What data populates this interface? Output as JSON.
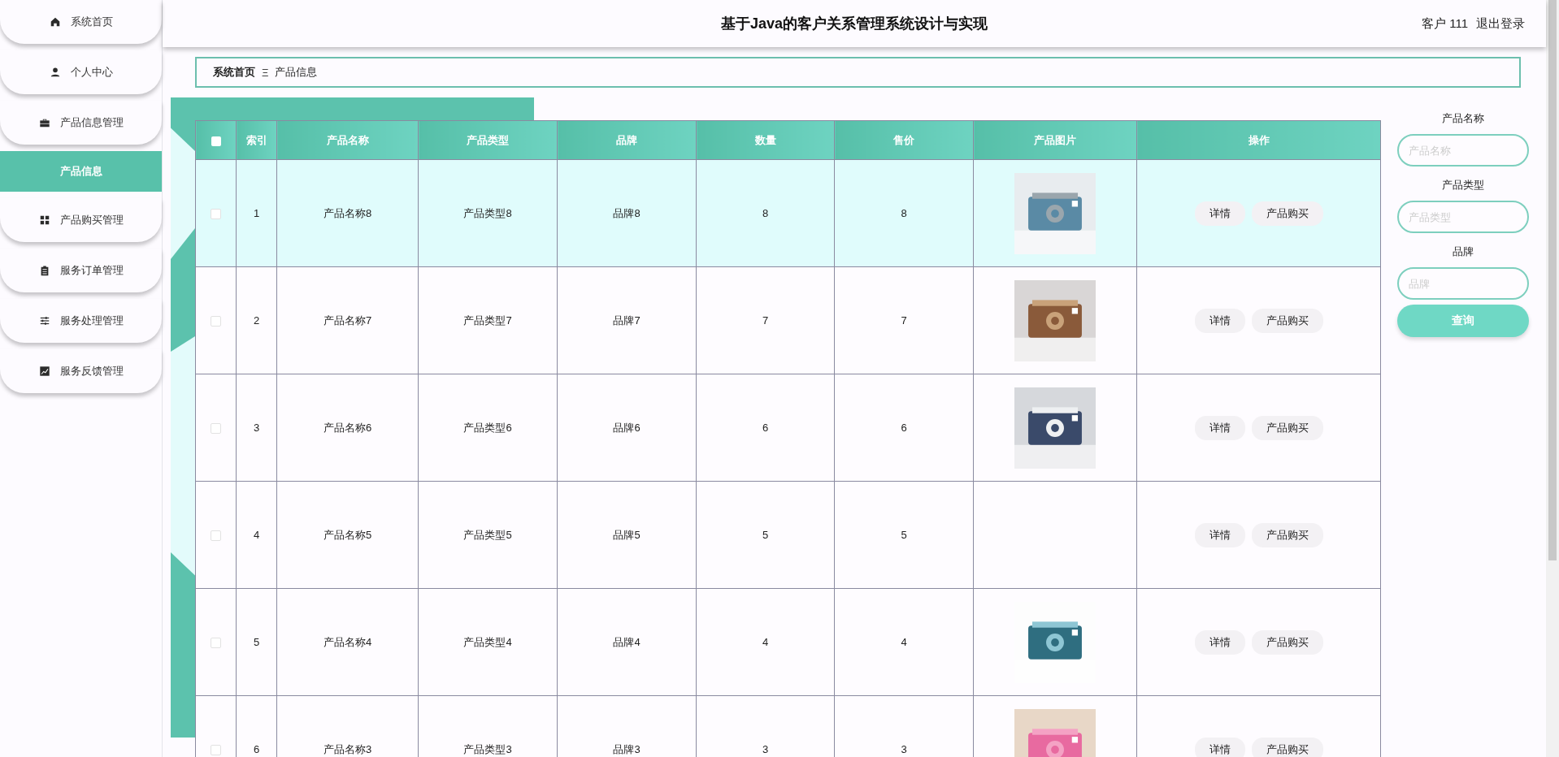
{
  "sidebar": {
    "items": [
      {
        "label": "系统首页",
        "selected": false
      },
      {
        "label": "个人中心",
        "selected": false
      },
      {
        "label": "产品信息管理",
        "selected": false,
        "expanded": true,
        "children": [
          {
            "label": "产品信息",
            "selected": true
          }
        ]
      },
      {
        "label": "产品购买管理",
        "selected": false
      },
      {
        "label": "服务订单管理",
        "selected": false
      },
      {
        "label": "服务处理管理",
        "selected": false
      },
      {
        "label": "服务反馈管理",
        "selected": false
      }
    ]
  },
  "header": {
    "title": "基于Java的客户关系管理系统设计与实现",
    "user": "客户 111",
    "logout": "退出登录"
  },
  "breadcrumb": {
    "items": [
      "系统首页",
      "产品信息"
    ],
    "separator": "Ξ"
  },
  "table": {
    "select_all_checked": false,
    "columns": [
      "索引",
      "产品名称",
      "产品类型",
      "品牌",
      "数量",
      "售价",
      "产品图片",
      "操作"
    ],
    "rows": [
      {
        "checked": false,
        "highlighted": true,
        "index": "1",
        "name": "产品名称8",
        "type": "产品类型8",
        "brand": "品牌8",
        "quantity": "8",
        "price": "8",
        "has_picture": true,
        "actions": [
          "详情",
          "产品购买"
        ]
      },
      {
        "checked": false,
        "highlighted": false,
        "index": "2",
        "name": "产品名称7",
        "type": "产品类型7",
        "brand": "品牌7",
        "quantity": "7",
        "price": "7",
        "has_picture": true,
        "actions": [
          "详情",
          "产品购买"
        ]
      },
      {
        "checked": false,
        "highlighted": false,
        "index": "3",
        "name": "产品名称6",
        "type": "产品类型6",
        "brand": "品牌6",
        "quantity": "6",
        "price": "6",
        "has_picture": true,
        "actions": [
          "详情",
          "产品购买"
        ]
      },
      {
        "checked": false,
        "highlighted": false,
        "index": "4",
        "name": "产品名称5",
        "type": "产品类型5",
        "brand": "品牌5",
        "quantity": "5",
        "price": "5",
        "has_picture": false,
        "actions": [
          "详情",
          "产品购买"
        ]
      },
      {
        "checked": false,
        "highlighted": false,
        "index": "5",
        "name": "产品名称4",
        "type": "产品类型4",
        "brand": "品牌4",
        "quantity": "4",
        "price": "4",
        "has_picture": true,
        "actions": [
          "详情",
          "产品购买"
        ]
      },
      {
        "checked": false,
        "highlighted": false,
        "index": "6",
        "name": "产品名称3",
        "type": "产品类型3",
        "brand": "品牌3",
        "quantity": "3",
        "price": "3",
        "has_picture": true,
        "actions": [
          "详情",
          "产品购买"
        ]
      }
    ]
  },
  "search": {
    "fields": [
      {
        "label": "产品名称",
        "placeholder": "产品名称"
      },
      {
        "label": "产品类型",
        "placeholder": "产品类型"
      },
      {
        "label": "品牌",
        "placeholder": "品牌"
      }
    ],
    "button": "查询"
  }
}
